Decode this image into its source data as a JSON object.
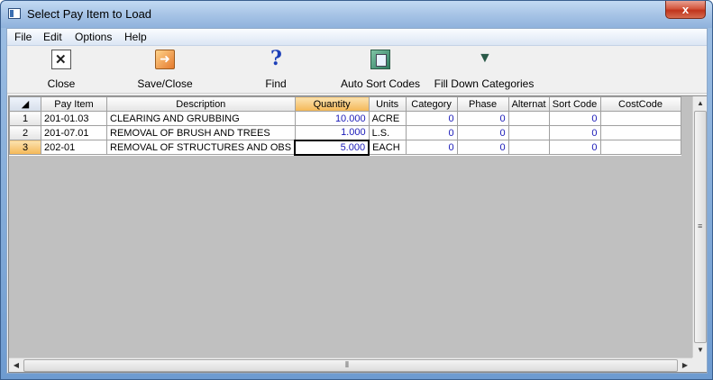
{
  "window": {
    "title": "Select Pay Item to Load",
    "close_glyph": "x"
  },
  "menu": [
    "File",
    "Edit",
    "Options",
    "Help"
  ],
  "toolbar": {
    "close": "Close",
    "save_close": "Save/Close",
    "find": "Find",
    "auto_sort": "Auto Sort Codes",
    "fill_down": "Fill Down Categories"
  },
  "grid": {
    "columns": [
      "Pay Item",
      "Description",
      "Quantity",
      "Units",
      "Category",
      "Phase",
      "Alternat",
      "Sort Code",
      "CostCode"
    ],
    "rows": [
      {
        "num": "1",
        "pay_item": "201-01.03",
        "description": "CLEARING AND GRUBBING",
        "quantity": "10.000",
        "units": "ACRE",
        "category": "0",
        "phase": "0",
        "alternat": "",
        "sort_code": "0",
        "costcode": ""
      },
      {
        "num": "2",
        "pay_item": "201-07.01",
        "description": "REMOVAL OF BRUSH AND TREES",
        "quantity": "1.000",
        "units": "L.S.",
        "category": "0",
        "phase": "0",
        "alternat": "",
        "sort_code": "0",
        "costcode": ""
      },
      {
        "num": "3",
        "pay_item": "202-01",
        "description": "REMOVAL OF STRUCTURES AND OBS",
        "quantity": "5.000",
        "units": "EACH",
        "category": "0",
        "phase": "0",
        "alternat": "",
        "sort_code": "0",
        "costcode": ""
      }
    ]
  },
  "colors": {
    "selected_header": "#f4b755",
    "number_text": "#1a1ab8",
    "title_close": "#c0341c"
  }
}
